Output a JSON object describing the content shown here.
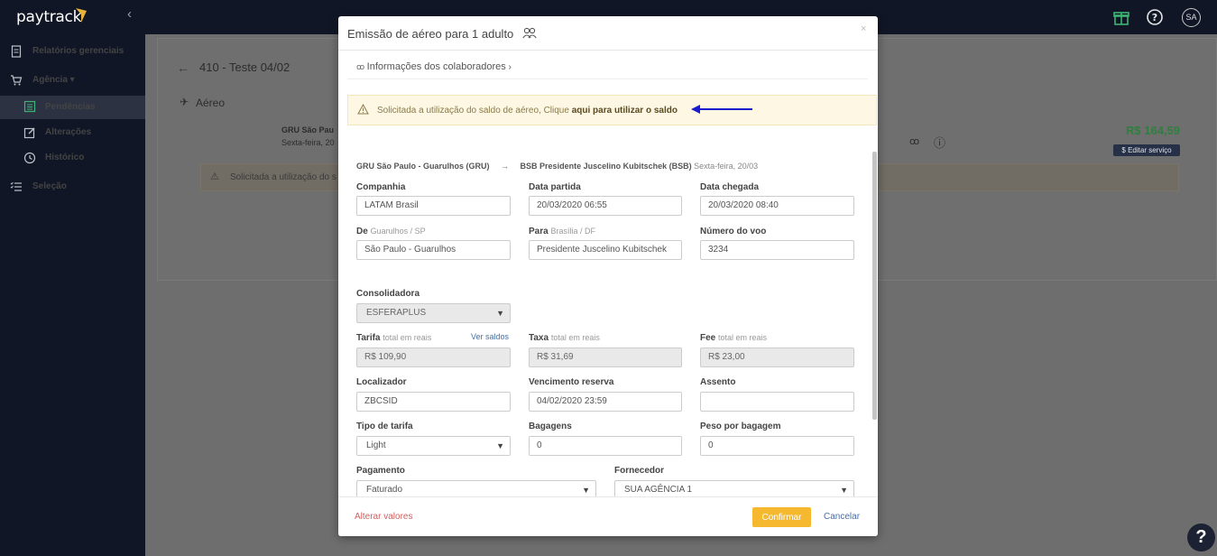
{
  "app": {
    "logo": "paytrack",
    "avatar_initials": "SA"
  },
  "sidebar": {
    "items": [
      {
        "label": "Relatórios gerenciais"
      },
      {
        "label": "Agência"
      },
      {
        "label": "Pendências"
      },
      {
        "label": "Alterações"
      },
      {
        "label": "Histórico"
      },
      {
        "label": "Seleção"
      }
    ]
  },
  "background": {
    "page_title": "410 - Teste 04/02",
    "section": "Aéreo",
    "flight_title": "GRU São Pau",
    "flight_date": "Sexta-feira, 20",
    "price": "R$ 164,59",
    "edit_service": "$ Editar serviço",
    "alert_text": "Solicitada a utilização do s"
  },
  "modal": {
    "title": "Emissão de aéreo para 1 adulto",
    "close": "×",
    "collaborators": "Informações dos colaboradores",
    "alert": {
      "prefix": "Solicitada a utilização do saldo de aéreo, Clique ",
      "link": "aqui para utilizar o saldo"
    },
    "route": {
      "origin": "GRU São Paulo - Guarulhos (GRU)",
      "arrow": "→",
      "destination": "BSB Presidente Juscelino Kubitschek (BSB)",
      "date": "Sexta-feira, 20/03"
    },
    "fields": {
      "companhia": {
        "label": "Companhia",
        "value": "LATAM Brasil"
      },
      "data_partida": {
        "label": "Data partida",
        "value": "20/03/2020 06:55"
      },
      "data_chegada": {
        "label": "Data chegada",
        "value": "20/03/2020 08:40"
      },
      "de": {
        "label": "De",
        "hint": "Guarulhos / SP",
        "value": "São Paulo - Guarulhos"
      },
      "para": {
        "label": "Para",
        "hint": "Brasília / DF",
        "value": "Presidente Juscelino Kubitschek"
      },
      "numero_voo": {
        "label": "Número do voo",
        "value": "3234"
      },
      "consolidadora": {
        "label": "Consolidadora",
        "value": "ESFERAPLUS"
      },
      "tarifa": {
        "label": "Tarifa",
        "hint": "total em reais",
        "value": "R$ 109,90",
        "link": "Ver saldos"
      },
      "taxa": {
        "label": "Taxa",
        "hint": "total em reais",
        "value": "R$ 31,69"
      },
      "fee": {
        "label": "Fee",
        "hint": "total em reais",
        "value": "R$ 23,00"
      },
      "localizador": {
        "label": "Localizador",
        "value": "ZBCSID"
      },
      "vencimento": {
        "label": "Vencimento reserva",
        "value": "04/02/2020 23:59"
      },
      "assento": {
        "label": "Assento",
        "value": ""
      },
      "tipo_tarifa": {
        "label": "Tipo de tarifa",
        "value": "Light"
      },
      "bagagens": {
        "label": "Bagagens",
        "value": "0"
      },
      "peso_bagagem": {
        "label": "Peso por bagagem",
        "value": "0"
      },
      "pagamento": {
        "label": "Pagamento",
        "value": "Faturado"
      },
      "fornecedor": {
        "label": "Fornecedor",
        "value": "SUA AGÊNCIA 1"
      }
    },
    "footer": {
      "alter_values": "Alterar valores",
      "confirm": "Confirmar",
      "cancel": "Cancelar"
    }
  },
  "colors": {
    "accent": "#f5b82e",
    "sidebar_bg": "#111626",
    "link": "#4a6fa5",
    "danger_link": "#d06060",
    "price_green": "#2f7f3f"
  }
}
